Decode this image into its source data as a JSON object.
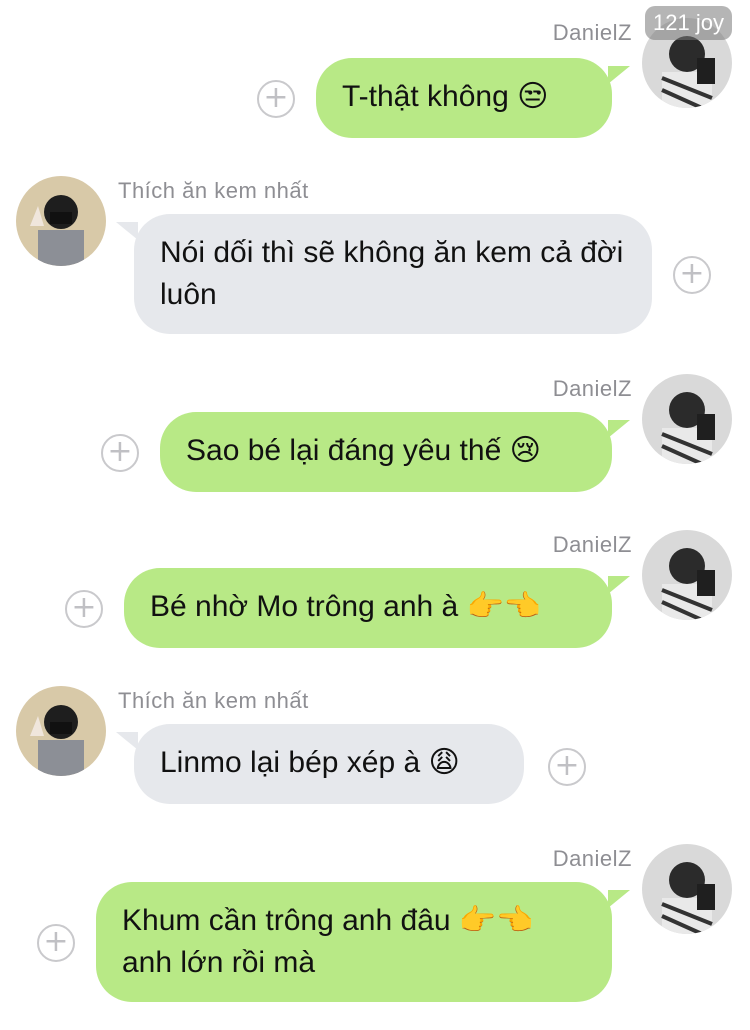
{
  "watermark": "121 joy",
  "contacts": {
    "me": "DanielZ",
    "them": "Thích ăn kem nhất"
  },
  "messages": [
    {
      "from": "me",
      "text": "T-thật không 😒"
    },
    {
      "from": "them",
      "text": "Nói dối thì sẽ không ăn kem cả đời luôn"
    },
    {
      "from": "me",
      "text": "Sao bé lại đáng yêu thế 😢"
    },
    {
      "from": "me",
      "text": "Bé nhờ Mo trông anh à 👉👈"
    },
    {
      "from": "them",
      "text": "Linmo lại bép xép à 😩"
    },
    {
      "from": "me",
      "text": "Khum cần trông anh đâu 👉👈 anh lớn rồi mà"
    }
  ],
  "icons": {
    "add": "+"
  }
}
